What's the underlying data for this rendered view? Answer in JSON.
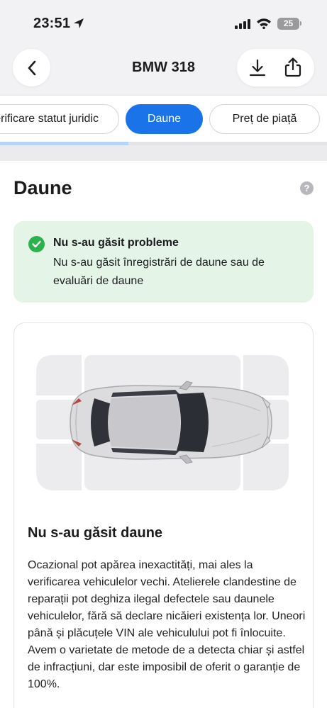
{
  "status_bar": {
    "time": "23:51",
    "battery": "25"
  },
  "header": {
    "title": "BMW 318"
  },
  "tabs": [
    {
      "label": "Verificare statut juridic",
      "active": false
    },
    {
      "label": "Daune",
      "active": true
    },
    {
      "label": "Preț de piață",
      "active": false
    }
  ],
  "section": {
    "title": "Daune",
    "help": "?"
  },
  "alert": {
    "title": "Nu s-au găsit probleme",
    "text": "Nu s-au găsit înregistrări de daune sau de evaluări de daune"
  },
  "card": {
    "title": "Nu s-au găsit daune",
    "text": "Ocazional pot apărea inexactități, mai ales la verificarea vehiculelor vechi. Atelierele clandestine de reparații pot deghiza ilegal defectele sau daunele vehiculelor, fără să declare nicăieri existența lor. Uneori până și plăcuțele VIN ale vehiculului pot fi înlocuite. Avem o varietate de metode de a detecta chiar și astfel de infracțiuni, dar este imposibil de oferit o garanție de 100%."
  },
  "colors": {
    "accent": "#1a73e8",
    "success": "#2bb24c",
    "alert_bg": "#e4f5e7",
    "zone_fill": "#ececee"
  },
  "icons": [
    "location-arrow-icon",
    "signal-icon",
    "wifi-icon",
    "battery-icon",
    "chevron-left-icon",
    "download-icon",
    "share-icon",
    "help-icon",
    "checkmark-icon"
  ]
}
